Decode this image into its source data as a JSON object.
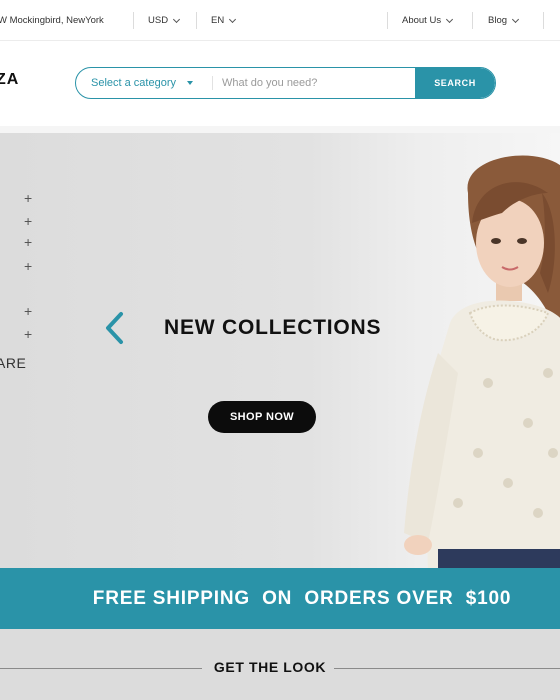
{
  "topbar": {
    "address": "W Mockingbird, NewYork",
    "currency": "USD",
    "language": "EN",
    "nav": [
      "About Us",
      "Blog"
    ]
  },
  "header": {
    "logo": "ZA",
    "search": {
      "category_label": "Select a category",
      "placeholder": "What do you need?",
      "button_label": "SEARCH"
    }
  },
  "hero": {
    "side_text": "ARE",
    "title": "NEW COLLECTIONS",
    "cta_label": "SHOP NOW"
  },
  "promo": {
    "text": "FREE SHIPPING  ON  ORDERS OVER  $100"
  },
  "section": {
    "title": "GET THE LOOK"
  },
  "colors": {
    "accent": "#2a93a8",
    "dark": "#0c0c0c",
    "hero_bg": "#dcdcdc"
  },
  "icons": [
    "chevron-down-icon",
    "dropdown-triangle-icon",
    "plus-icon",
    "chevron-left-icon"
  ]
}
